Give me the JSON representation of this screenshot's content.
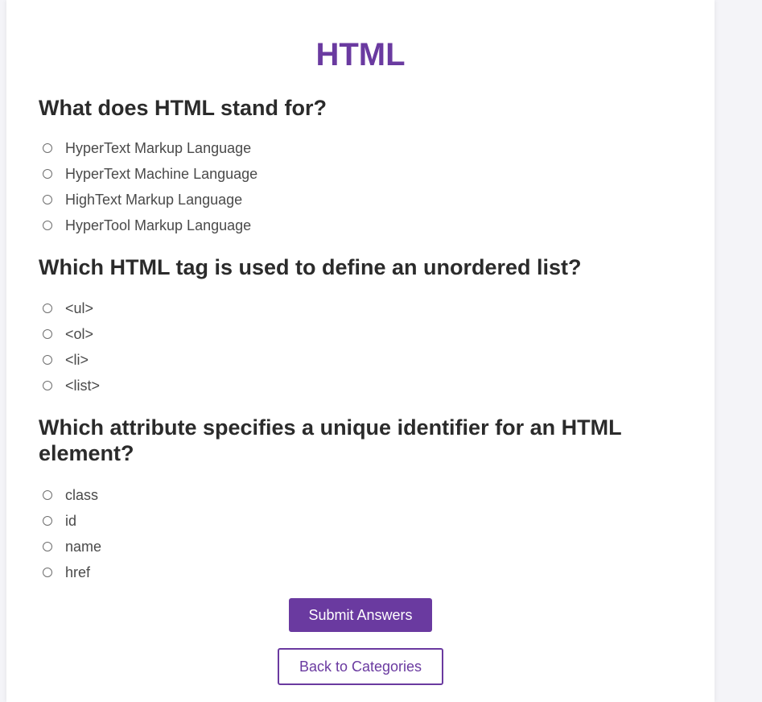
{
  "page": {
    "title": "HTML"
  },
  "questions": [
    {
      "text": "What does HTML stand for?",
      "options": [
        "HyperText Markup Language",
        "HyperText Machine Language",
        "HighText Markup Language",
        "HyperTool Markup Language"
      ]
    },
    {
      "text": "Which HTML tag is used to define an unordered list?",
      "options": [
        "<ul>",
        "<ol>",
        "<li>",
        "<list>"
      ]
    },
    {
      "text": "Which attribute specifies a unique identifier for an HTML element?",
      "options": [
        "class",
        "id",
        "name",
        "href"
      ]
    }
  ],
  "actions": {
    "submit_label": "Submit Answers",
    "back_label": "Back to Categories"
  },
  "colors": {
    "accent": "#6a3aa0",
    "text": "#2b2b2b",
    "option_text": "#4a4a4a"
  }
}
